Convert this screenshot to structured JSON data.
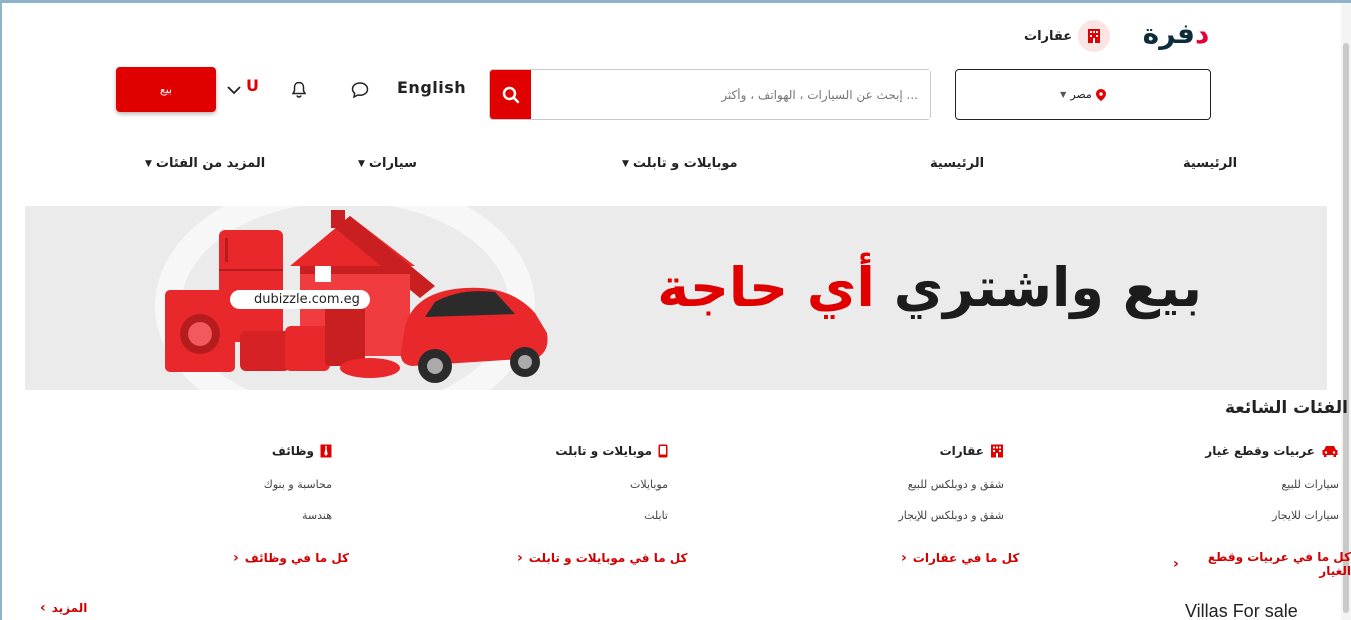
{
  "app": {
    "logo_text": "فرة",
    "logo_mark": "د"
  },
  "top": {
    "property_label": "عقارات"
  },
  "header": {
    "location": "مصر",
    "search_placeholder": "... إبحث عن السيارات ، الهواتف ، وأكثر",
    "language_label": "English",
    "avatar_letter": "U",
    "sell_label": "بيع"
  },
  "nav": {
    "items": [
      {
        "label": "الرئيسية"
      },
      {
        "label": "الرئيسية"
      },
      {
        "label": "موبايلات و تابلت"
      },
      {
        "label": "سيارات"
      },
      {
        "label": "المزيد من الفئات"
      }
    ]
  },
  "banner": {
    "headline_dark": "بيع واشتري",
    "headline_red": "أي حاجة",
    "url": "dubizzle.com.eg"
  },
  "popular": {
    "title": "الفئات الشائعة",
    "columns": [
      {
        "title": "عربيات وقطع غيار",
        "icon": "car-icon",
        "subs": [
          "سيارات للبيع",
          "سيارات للايجار"
        ],
        "see_all": "كل ما في عربيات وقطع الغيار"
      },
      {
        "title": "عقارات",
        "icon": "building-icon",
        "subs": [
          "شقق و دوبلكس للبيع",
          "شقق و دوبلكس للإيجار"
        ],
        "see_all": "كل ما في عقارات"
      },
      {
        "title": "موبايلات و تابلت",
        "icon": "phone-icon",
        "subs": [
          "موبايلات",
          "تابلت"
        ],
        "see_all": "كل ما في موبايلات و تابلت"
      },
      {
        "title": "وظائف",
        "icon": "tie-icon",
        "subs": [
          "محاسبة و بنوك",
          "هندسة"
        ],
        "see_all": "كل ما في وظائف"
      }
    ],
    "more_label": "المزيد"
  },
  "section2": {
    "title": "Villas For sale"
  },
  "colors": {
    "accent": "#e00000",
    "brand_dark": "#0e2d3a"
  }
}
